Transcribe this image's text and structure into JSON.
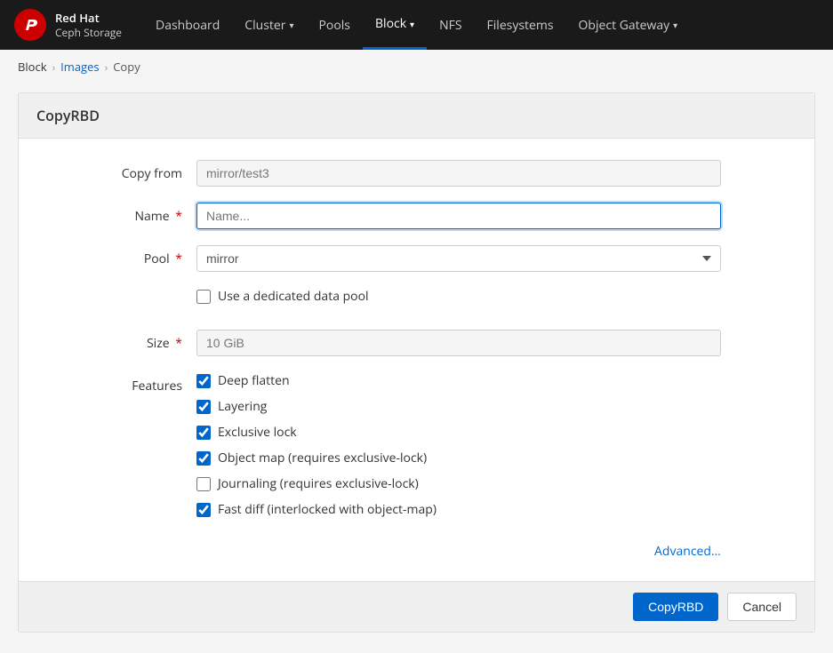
{
  "brand": {
    "red_hat": "Red Hat",
    "ceph": "Ceph Storage"
  },
  "navbar": {
    "items": [
      {
        "id": "dashboard",
        "label": "Dashboard",
        "active": false,
        "has_dropdown": false
      },
      {
        "id": "cluster",
        "label": "Cluster",
        "active": false,
        "has_dropdown": true
      },
      {
        "id": "pools",
        "label": "Pools",
        "active": false,
        "has_dropdown": false
      },
      {
        "id": "block",
        "label": "Block",
        "active": true,
        "has_dropdown": true
      },
      {
        "id": "nfs",
        "label": "NFS",
        "active": false,
        "has_dropdown": false
      },
      {
        "id": "filesystems",
        "label": "Filesystems",
        "active": false,
        "has_dropdown": false
      },
      {
        "id": "object-gateway",
        "label": "Object Gateway",
        "active": false,
        "has_dropdown": true
      }
    ]
  },
  "breadcrumb": {
    "items": [
      {
        "label": "Block",
        "href": "#",
        "is_link": false
      },
      {
        "label": "Images",
        "href": "#",
        "is_link": true
      },
      {
        "label": "Copy",
        "is_link": false
      }
    ]
  },
  "page": {
    "title": "CopyRBD"
  },
  "form": {
    "copy_from_label": "Copy from",
    "copy_from_value": "mirror/test3",
    "name_label": "Name",
    "name_placeholder": "Name...",
    "name_required": true,
    "pool_label": "Pool",
    "pool_required": true,
    "pool_value": "mirror",
    "pool_options": [
      "mirror"
    ],
    "dedicated_pool_label": "Use a dedicated data pool",
    "size_label": "Size",
    "size_required": true,
    "size_value": "10 GiB",
    "features_label": "Features",
    "features": [
      {
        "id": "deep-flatten",
        "label": "Deep flatten",
        "checked": true
      },
      {
        "id": "layering",
        "label": "Layering",
        "checked": true
      },
      {
        "id": "exclusive-lock",
        "label": "Exclusive lock",
        "checked": true
      },
      {
        "id": "object-map",
        "label": "Object map (requires exclusive-lock)",
        "checked": true
      },
      {
        "id": "journaling",
        "label": "Journaling (requires exclusive-lock)",
        "checked": false
      },
      {
        "id": "fast-diff",
        "label": "Fast diff (interlocked with object-map)",
        "checked": true
      }
    ],
    "advanced_link": "Advanced...",
    "copy_button": "CopyRBD",
    "cancel_button": "Cancel"
  }
}
